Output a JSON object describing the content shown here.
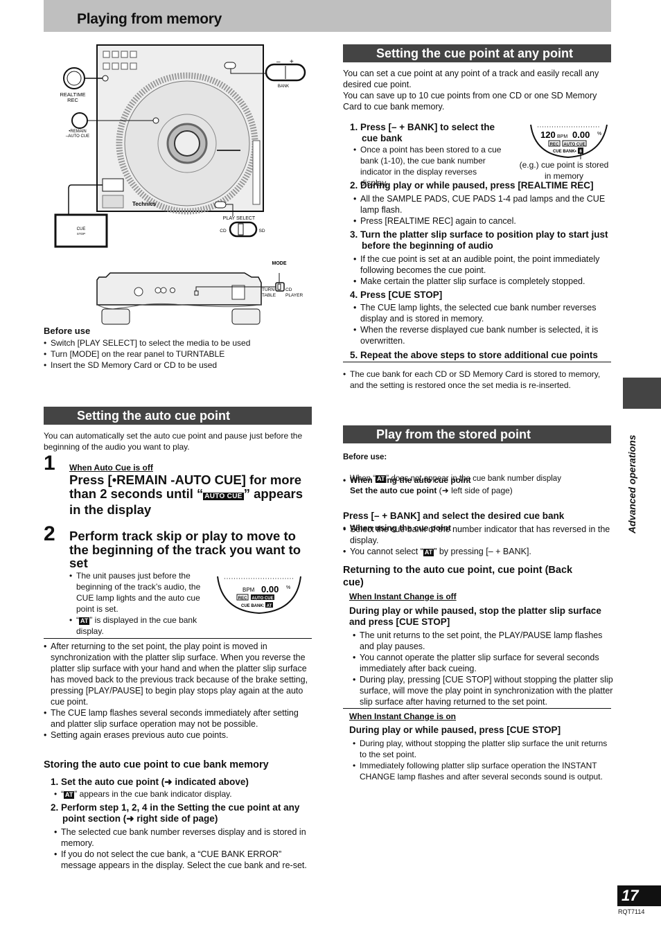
{
  "page": {
    "title": "Playing from memory",
    "side_tab_label": "Advanced operations",
    "page_number": "17",
    "doc_code": "RQT7114"
  },
  "figure_top": {
    "labels": {
      "realtime_rec": "REALTIME",
      "realtime_rec2": "REC",
      "remain": "•REMAIN",
      "auto_cue": "–AUTO CUE",
      "bank": "BANK",
      "minus": "–",
      "plus": "+",
      "play_select": "PLAY SELECT",
      "cd": "CD",
      "sd": "SD",
      "cue": "CUE",
      "stop": "STOP",
      "brand": "Technics"
    }
  },
  "figure_rear": {
    "labels": {
      "mode": "MODE",
      "turn": "TURN",
      "table": "TABLE",
      "cd": "CD",
      "player": "PLAYER"
    }
  },
  "before_use": {
    "heading": "Before use",
    "items": [
      "Switch [PLAY SELECT] to select the media to be used",
      "Turn [MODE] on the rear panel to TURNTABLE",
      "Insert the SD Memory Card or CD to be used"
    ]
  },
  "auto_cue": {
    "section_title": "Setting the auto cue point",
    "intro": "You can automatically set the auto cue point and pause just before the beginning of the audio you want to play.",
    "step1": {
      "number": "1",
      "condition": "When Auto Cue is off",
      "text_a": "Press [•REMAIN -AUTO CUE] for more than 2 seconds until “",
      "badge": "AUTO CUE",
      "text_b": "” appears in the display"
    },
    "step2": {
      "number": "2",
      "text": "Perform track skip or play to move to the beginning of the track you want to set",
      "bullets": [
        "The unit pauses just before the beginning of the track’s audio, the CUE lamp lights and the auto cue point is set.",
        "“AT” is displayed in the cue bank display."
      ],
      "at_badge": "AT",
      "at_suffix": "” is displayed in the cue bank display."
    },
    "display": {
      "bpm_label": "BPM",
      "pitch": "0.00",
      "percent": "%",
      "rec": "REC",
      "auto_cue": "AUTO CUE",
      "cue_bank": "CUE BANK:",
      "bank_value": "AT"
    },
    "notes": [
      "After returning to the set point, the play point is moved in synchronization with the platter slip surface. When you reverse the platter slip surface with your hand and when the platter slip surface has moved back to the previous track because of the brake setting, pressing [PLAY/PAUSE] to begin play stops play again at the auto cue point.",
      "The CUE lamp flashes several seconds immediately after setting and platter slip surface operation may not be possible.",
      "Setting again erases previous auto cue points."
    ]
  },
  "storing": {
    "heading": "Storing the auto cue point to cue bank memory",
    "step1": "1. Set the auto cue point (➜ indicated above)",
    "step1_bullet_suffix": "” appears in the cue bank indicator display.",
    "step2": "2. Perform step 1, 2, 4 in the Setting the cue point at any point section (➜ right side of page)",
    "step2_bullets": [
      "The selected cue bank number reverses display and is stored in memory.",
      "If you do not select the cue bank, a “CUE BANK ERROR” message appears in the display. Select the cue bank and re-set."
    ]
  },
  "cue_any": {
    "section_title": "Setting the cue point at any point",
    "intro1": "You can set a cue point at any point of a track and easily recall any desired cue point.",
    "intro2": "You can save up to 10 cue points from one CD or one SD Memory Card to cue bank memory.",
    "display": {
      "bpm_value": "120",
      "bpm_label": "BPM",
      "pitch": "0.00",
      "percent": "%",
      "rec": "REC",
      "auto_cue": "AUTO CUE",
      "cue_bank": "CUE BANK•",
      "bank_value": "8",
      "caption": "(e.g.) cue point is stored in memory"
    },
    "steps": [
      {
        "title": "1. Press [– + BANK] to select the cue bank",
        "bullets": [
          "Once a point has been stored to a cue bank (1-10), the cue bank number indicator in the display reverses display."
        ]
      },
      {
        "title": "2. During play or while paused, press [REALTIME REC]",
        "bullets": [
          "All the SAMPLE PADS, CUE PADS 1-4 pad lamps and the CUE lamp flash.",
          "Press [REALTIME REC] again to cancel."
        ]
      },
      {
        "title": "3. Turn the platter slip surface to position play to start just before the beginning of audio",
        "bullets": [
          "If the cue point is set at an audible point, the point immediately following becomes the cue point.",
          "Make certain the platter slip surface is completely stopped."
        ]
      },
      {
        "title": "4. Press [CUE STOP]",
        "bullets": [
          "The CUE lamp lights, the selected cue bank number reverses display and is stored in memory.",
          "When the reverse displayed cue bank number is selected, it is overwritten."
        ]
      },
      {
        "title": "5. Repeat the above steps to store additional cue points",
        "bullets": []
      }
    ],
    "note": "The cue bank for each CD or SD Memory Card is stored to memory, and the setting is restored once the set media is re-inserted."
  },
  "play_stored": {
    "section_title": "Play from the stored point",
    "before_use": "Before use:",
    "auto_cue_case": "When using the auto cue point",
    "auto_cue_note_a": "When “",
    "auto_cue_note_b": "” does not appear in the cue bank number display",
    "set_auto_bold": "Set the auto cue point",
    "set_auto_rest": " (➜ left side of page)",
    "cue_point_case": "When using the cue point",
    "press_bank": "Press [– + BANK] and select the desired cue bank",
    "bank_bullets": [
      "Select the cue bank of the number indicator that has reversed in the display."
    ],
    "cannot_a": "You cannot select “",
    "cannot_b": "” by pressing [– + BANK].",
    "returning_heading": "Returning to the auto cue point, cue point (Back cue)",
    "off": {
      "condition": "When Instant Change is off",
      "instruction": "During play or while paused, stop the platter slip surface and press [CUE STOP]",
      "bullets": [
        "The unit returns to the set point, the PLAY/PAUSE lamp flashes and play pauses.",
        "You cannot operate the platter slip surface for several seconds immediately after back cueing.",
        "During play, pressing [CUE STOP] without stopping the platter slip surface, will move the play point in synchronization with the platter slip surface after having returned to the set point."
      ]
    },
    "on": {
      "condition": "When Instant Change is on",
      "instruction": "During play or while paused, press [CUE STOP]",
      "bullets": [
        "During play, without stopping the platter slip surface the unit returns to the set point.",
        "Immediately following platter slip surface operation the INSTANT CHANGE lamp flashes and after several seconds sound is output."
      ]
    }
  }
}
